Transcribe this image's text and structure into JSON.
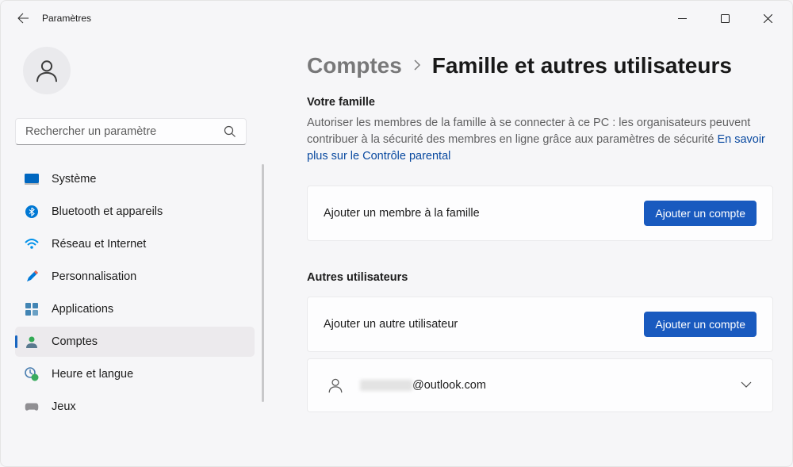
{
  "app_title": "Paramètres",
  "window_controls": {
    "minimize": "minimize",
    "maximize": "maximize",
    "close": "close"
  },
  "search": {
    "placeholder": "Rechercher un paramètre"
  },
  "sidebar": {
    "items": [
      {
        "label": "Système",
        "icon": "system"
      },
      {
        "label": "Bluetooth et appareils",
        "icon": "bluetooth"
      },
      {
        "label": "Réseau et Internet",
        "icon": "network"
      },
      {
        "label": "Personnalisation",
        "icon": "personalization"
      },
      {
        "label": "Applications",
        "icon": "apps"
      },
      {
        "label": "Comptes",
        "icon": "accounts",
        "selected": true
      },
      {
        "label": "Heure et langue",
        "icon": "time-language"
      },
      {
        "label": "Jeux",
        "icon": "gaming"
      }
    ]
  },
  "breadcrumb": {
    "parent": "Comptes",
    "current": "Famille et autres utilisateurs"
  },
  "family": {
    "title": "Votre famille",
    "description": "Autoriser les membres de la famille à se connecter à ce PC : les organisateurs peuvent contribuer à la sécurité des membres en ligne grâce aux paramètres de sécurité  ",
    "link_text": "En savoir plus sur le Contrôle parental",
    "add_label": "Ajouter un membre à la famille",
    "add_button": "Ajouter un compte"
  },
  "others": {
    "title": "Autres utilisateurs",
    "add_label": "Ajouter un autre utilisateur",
    "add_button": "Ajouter un compte",
    "user_email_domain": "@outlook.com"
  }
}
